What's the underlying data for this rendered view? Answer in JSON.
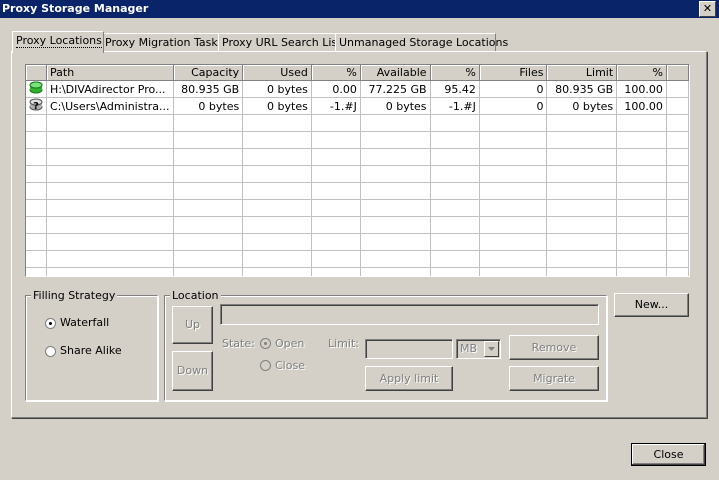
{
  "window": {
    "title": "Proxy Storage Manager",
    "close_glyph": "✕"
  },
  "tabs": [
    {
      "label": "Proxy Locations"
    },
    {
      "label": "Proxy Migration Tasks"
    },
    {
      "label": "Proxy URL Search List"
    },
    {
      "label": "Unmanaged Storage Locations"
    }
  ],
  "table": {
    "columns": [
      "Path",
      "Capacity",
      "Used",
      "%",
      "Available",
      "%",
      "Files",
      "Limit",
      "%"
    ],
    "rows": [
      {
        "icon": "green-disk-icon",
        "cells": [
          "H:\\DIVAdirector Pro...",
          "80.935 GB",
          "0 bytes",
          "0.00",
          "77.225 GB",
          "95.42",
          "0",
          "80.935 GB",
          "100.00"
        ]
      },
      {
        "icon": "unknown-disk-icon",
        "cells": [
          "C:\\Users\\Administra...",
          "0 bytes",
          "0 bytes",
          "-1.#J",
          "0 bytes",
          "-1.#J",
          "0",
          "0 bytes",
          "100.00"
        ]
      }
    ]
  },
  "filling_strategy": {
    "legend": "Filling Strategy",
    "options": [
      {
        "label": "Waterfall",
        "checked": true
      },
      {
        "label": "Share Alike",
        "checked": false
      }
    ]
  },
  "location": {
    "legend": "Location",
    "up_label": "Up",
    "down_label": "Down",
    "path_value": "",
    "state_label": "State:",
    "open_label": "Open",
    "close_label": "Close",
    "limit_label": "Limit:",
    "limit_value": "",
    "unit_value": "MB",
    "remove_label": "Remove",
    "apply_limit_label": "Apply limit",
    "migrate_label": "Migrate"
  },
  "buttons": {
    "new_label": "New...",
    "close_label": "Close"
  }
}
